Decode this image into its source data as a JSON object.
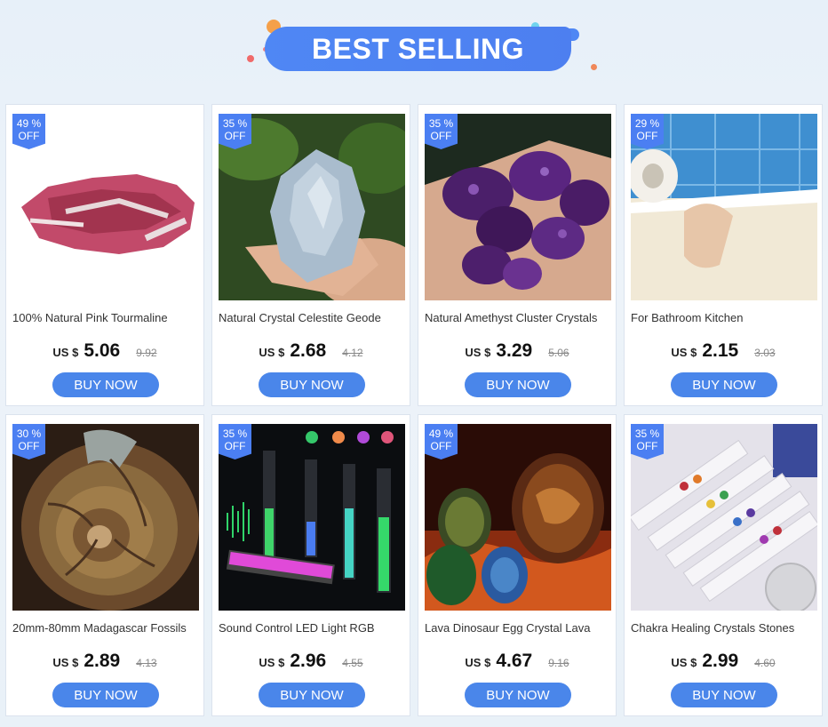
{
  "header": {
    "title": "BEST SELLING"
  },
  "colors": {
    "accent": "#4a86ea",
    "badge": "#4b7ff2",
    "banner": "#4f87f4"
  },
  "products": [
    {
      "pct": "49 %",
      "off": "OFF",
      "name": "100% Natural Pink Tourmaline",
      "currency": "US $",
      "price": "5.06",
      "old_price": "9.92",
      "buy": "BUY NOW",
      "image": "pink-tourmaline-stone"
    },
    {
      "pct": "35 %",
      "off": "OFF",
      "name": "Natural Crystal Celestite Geode",
      "currency": "US $",
      "price": "2.68",
      "old_price": "4.12",
      "buy": "BUY NOW",
      "image": "celestite-geode-in-hand"
    },
    {
      "pct": "35 %",
      "off": "OFF",
      "name": "Natural Amethyst Cluster Crystals",
      "currency": "US $",
      "price": "3.29",
      "old_price": "5.06",
      "buy": "BUY NOW",
      "image": "amethyst-clusters-in-hand"
    },
    {
      "pct": "29 %",
      "off": "OFF",
      "name": "For Bathroom Kitchen",
      "currency": "US $",
      "price": "2.15",
      "old_price": "3.03",
      "buy": "BUY NOW",
      "image": "bathroom-sealing-tape"
    },
    {
      "pct": "30 %",
      "off": "OFF",
      "name": "20mm-80mm Madagascar Fossils",
      "currency": "US $",
      "price": "2.89",
      "old_price": "4.13",
      "buy": "BUY NOW",
      "image": "ammonite-fossil"
    },
    {
      "pct": "35 %",
      "off": "OFF",
      "name": "Sound Control LED Light RGB",
      "currency": "US $",
      "price": "2.96",
      "old_price": "4.55",
      "buy": "BUY NOW",
      "image": "rgb-sound-led-bars"
    },
    {
      "pct": "49 %",
      "off": "OFF",
      "name": "Lava Dinosaur Egg Crystal Lava",
      "currency": "US $",
      "price": "4.67",
      "old_price": "9.16",
      "buy": "BUY NOW",
      "image": "dragon-egg-lava"
    },
    {
      "pct": "35 %",
      "off": "OFF",
      "name": "Chakra Healing Crystals Stones",
      "currency": "US $",
      "price": "2.99",
      "old_price": "4.60",
      "buy": "BUY NOW",
      "image": "chakra-crystal-wands"
    }
  ]
}
